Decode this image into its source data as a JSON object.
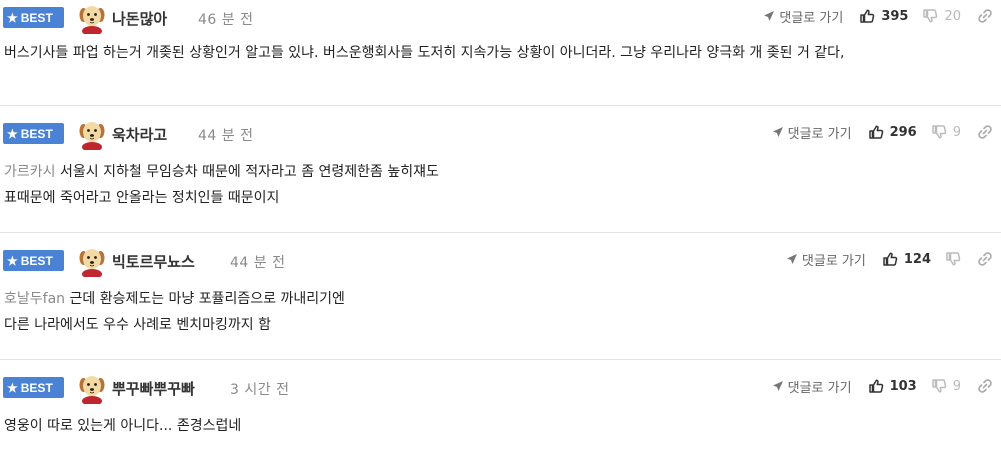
{
  "badge": {
    "label": "BEST"
  },
  "action_labels": {
    "reply": "댓글로 가기"
  },
  "icons": {
    "badge": "star-icon",
    "avatar": "puppy-avatar-icon",
    "reply": "send-arrow-icon",
    "like": "thumbs-up-icon",
    "dislike": "thumbs-down-icon",
    "share": "link-icon"
  },
  "colors": {
    "badge_bg": "#4a83d6",
    "mention": "#8a8a8a",
    "time": "#8a8a8a"
  },
  "comments": [
    {
      "nickname": "나돈많아",
      "time": "46 분 전",
      "likes": "395",
      "dislikes": "20",
      "mention": "",
      "text": "버스기사들 파업 하는거 개좆된 상황인거 알고들 있냐. 버스운행회사들 도저히 지속가능 상황이 아니더라. 그냥 우리나라 양극화 개 좆된 거 같다,"
    },
    {
      "nickname": "욱차라고",
      "time": "44 분 전",
      "likes": "296",
      "dislikes": "9",
      "mention": "가르카시",
      "line1": "서울시 지하철 무임승차 때문에 적자라고 좀 연령제한좀 높히쟤도",
      "line2": "표때문에 죽어라고 안올라는 정치인들 때문이지"
    },
    {
      "nickname": "빅토르무뇨스",
      "time": "44 분 전",
      "likes": "124",
      "dislikes": "",
      "mention": "호날두fan",
      "line1": "근데 환승제도는 마냥 포퓰리즘으로 까내리기엔",
      "line2": "다른 나라에서도 우수 사례로 벤치마킹까지 함"
    },
    {
      "nickname": "뿌꾸빠뿌꾸빠",
      "time": "3 시간 전",
      "likes": "103",
      "dislikes": "9",
      "mention": "",
      "text": "영웅이 따로 있는게 아니다... 존경스럽네"
    }
  ]
}
